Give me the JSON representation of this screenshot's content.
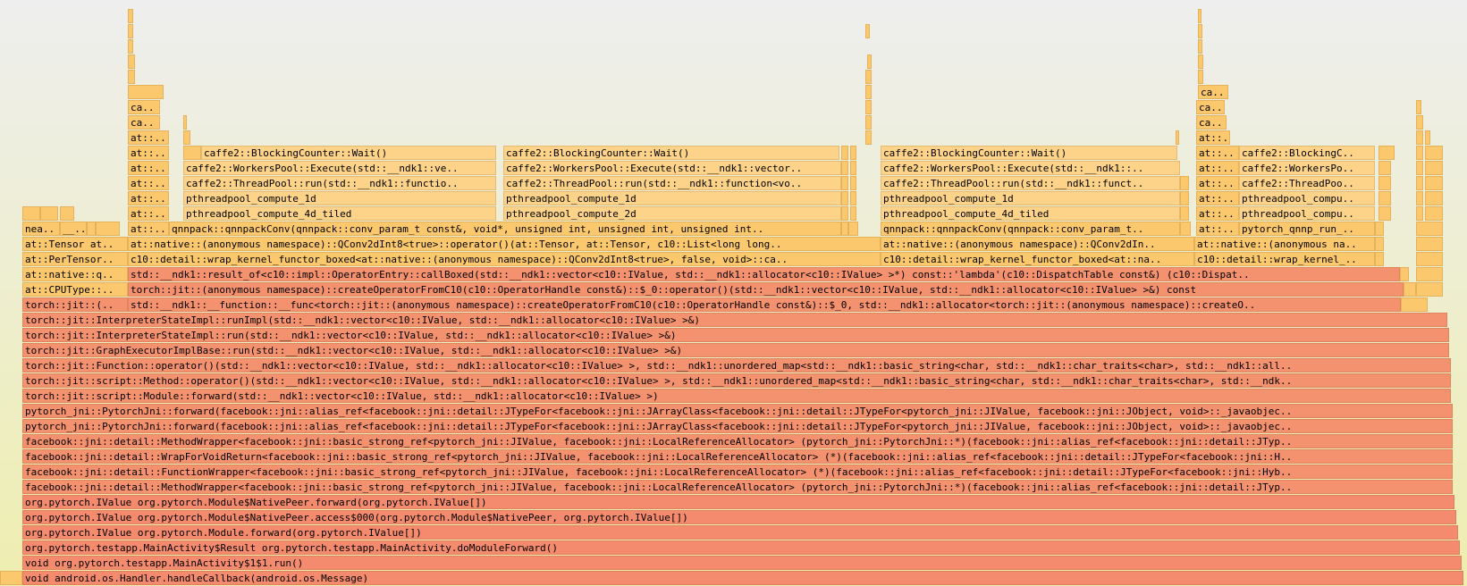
{
  "colors": {
    "java": "#f58b6e",
    "jvm": "#f49270",
    "native": "#fbc86e",
    "threadpool": "#fdd38a",
    "kernel": "#f8c374",
    "system": "#f6b36b"
  },
  "frames": {
    "r0": "void android.os.Handler.handleCallback(android.os.Message)",
    "r1": "void org.pytorch.testapp.MainActivity$1$1.run()",
    "r2": "org.pytorch.testapp.MainActivity$Result org.pytorch.testapp.MainActivity.doModuleForward()",
    "r3": "org.pytorch.IValue org.pytorch.Module.forward(org.pytorch.IValue[])",
    "r4": "org.pytorch.IValue org.pytorch.Module$NativePeer.access$000(org.pytorch.Module$NativePeer, org.pytorch.IValue[])",
    "r5": "org.pytorch.IValue org.pytorch.Module$NativePeer.forward(org.pytorch.IValue[])",
    "r6": "facebook::jni::detail::MethodWrapper<facebook::jni::basic_strong_ref<pytorch_jni::JIValue, facebook::jni::LocalReferenceAllocator> (pytorch_jni::PytorchJni::*)(facebook::jni::alias_ref<facebook::jni::detail::JTyp..",
    "r7": "facebook::jni::detail::FunctionWrapper<facebook::jni::basic_strong_ref<pytorch_jni::JIValue, facebook::jni::LocalReferenceAllocator> (*)(facebook::jni::alias_ref<facebook::jni::detail::JTypeFor<facebook::jni::Hyb..",
    "r8": "facebook::jni::detail::WrapForVoidReturn<facebook::jni::basic_strong_ref<pytorch_jni::JIValue, facebook::jni::LocalReferenceAllocator> (*)(facebook::jni::alias_ref<facebook::jni::detail::JTypeFor<facebook::jni::H..",
    "r9": "facebook::jni::detail::MethodWrapper<facebook::jni::basic_strong_ref<pytorch_jni::JIValue, facebook::jni::LocalReferenceAllocator> (pytorch_jni::PytorchJni::*)(facebook::jni::alias_ref<facebook::jni::detail::JTyp..",
    "r10": "pytorch_jni::PytorchJni::forward(facebook::jni::alias_ref<facebook::jni::detail::JTypeFor<facebook::jni::JArrayClass<facebook::jni::detail::JTypeFor<pytorch_jni::JIValue, facebook::jni::JObject, void>::_javaobjec..",
    "r11": "pytorch_jni::PytorchJni::forward(facebook::jni::alias_ref<facebook::jni::detail::JTypeFor<facebook::jni::JArrayClass<facebook::jni::detail::JTypeFor<pytorch_jni::JIValue, facebook::jni::JObject, void>::_javaobjec..",
    "r12": "torch::jit::script::Module::forward(std::__ndk1::vector<c10::IValue, std::__ndk1::allocator<c10::IValue> >)",
    "r13": "torch::jit::script::Method::operator()(std::__ndk1::vector<c10::IValue, std::__ndk1::allocator<c10::IValue> >, std::__ndk1::unordered_map<std::__ndk1::basic_string<char, std::__ndk1::char_traits<char>, std::__ndk..",
    "r14": "torch::jit::Function::operator()(std::__ndk1::vector<c10::IValue, std::__ndk1::allocator<c10::IValue> >, std::__ndk1::unordered_map<std::__ndk1::basic_string<char, std::__ndk1::char_traits<char>, std::__ndk1::all..",
    "r15": "torch::jit::GraphExecutorImplBase::run(std::__ndk1::vector<c10::IValue, std::__ndk1::allocator<c10::IValue> >&)",
    "r16": "torch::jit::InterpreterStateImpl::run(std::__ndk1::vector<c10::IValue, std::__ndk1::allocator<c10::IValue> >&)",
    "r17": "torch::jit::InterpreterStateImpl::runImpl(std::__ndk1::vector<c10::IValue, std::__ndk1::allocator<c10::IValue> >&)",
    "r18a": "torch::jit::(..",
    "r18b": "std::__ndk1::__function::__func<torch::jit::(anonymous namespace)::createOperatorFromC10(c10::OperatorHandle const&)::$_0, std::__ndk1::allocator<torch::jit::(anonymous namespace)::createO..",
    "r19a": "at::CPUType::..",
    "r19b": "torch::jit::(anonymous namespace)::createOperatorFromC10(c10::OperatorHandle const&)::$_0::operator()(std::__ndk1::vector<c10::IValue, std::__ndk1::allocator<c10::IValue> >&) const",
    "r20a": "at::native::q..",
    "r20b": "std::__ndk1::result_of<c10::impl::OperatorEntry::callBoxed(std::__ndk1::vector<c10::IValue, std::__ndk1::allocator<c10::IValue> >*) const::'lambda'(c10::DispatchTable const&) (c10::Dispat..",
    "r21a": "at::PerTensor..",
    "r21b": "c10::detail::wrap_kernel_functor_boxed<at::native::(anonymous namespace)::QConv2dInt8<true>, false, void>::ca..",
    "r21c": "c10::detail::wrap_kernel_functor_boxed<at::na..",
    "r21d": "c10::detail::wrap_kernel_..",
    "r22a": "at::Tensor at..",
    "r22b": "at::native::(anonymous namespace)::QConv2dInt8<true>::operator()(at::Tensor, at::Tensor, c10::List<long long..",
    "r22c": "at::native::(anonymous namespace)::QConv2dIn..",
    "r22d": "at::native::(anonymous na..",
    "r23a": "nea..",
    "r23b": "__..",
    "r23c": "at::..",
    "r23d": "qnnpack::qnnpackConv(qnnpack::conv_param_t const&, void*, unsigned int, unsigned int, unsigned int..",
    "r23e": "qnnpack::qnnpackConv(qnnpack::conv_param_t..",
    "r23f": "at::..",
    "r23g": "pytorch_qnnp_run_..",
    "pc4d1": "pthreadpool_compute_4d_tiled",
    "pc2d": "pthreadpool_compute_2d",
    "pc4d2": "pthreadpool_compute_4d_tiled",
    "pcomp": "pthreadpool_compu..",
    "pc1d1": "pthreadpool_compute_1d",
    "pc1d2": "pthreadpool_compute_1d",
    "pc1d3": "pthreadpool_compute_1d",
    "pcomp2": "pthreadpool_compu..",
    "tp1": "caffe2::ThreadPool::run(std::__ndk1::functio..",
    "tp2": "caffe2::ThreadPool::run(std::__ndk1::function<vo..",
    "tp3": "caffe2::ThreadPool::run(std::__ndk1::funct..",
    "tp4": "caffe2::ThreadPoo..",
    "wp1": "caffe2::WorkersPool::Execute(std::__ndk1::ve..",
    "wp2": "caffe2::WorkersPool::Execute(std::__ndk1::vector..",
    "wp3": "caffe2::WorkersPool::Execute(std::__ndk1::..",
    "wp4": "caffe2::WorkersPo..",
    "bc1": "caffe2::BlockingCounter::Wait()",
    "bc2": "caffe2::BlockingCounter::Wait()",
    "bc3": "caffe2::BlockingCounter::Wait()",
    "bc4": "caffe2::BlockingC..",
    "at": "at::..",
    "ca": "ca.."
  }
}
